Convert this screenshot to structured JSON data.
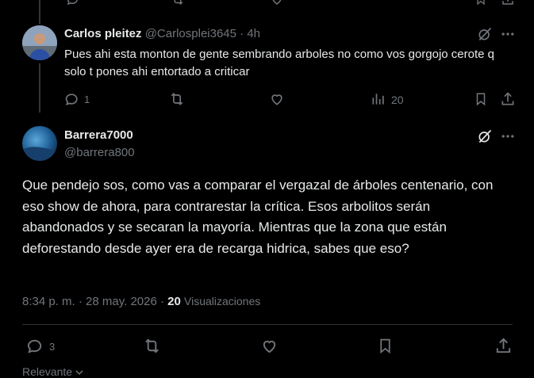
{
  "reply": {
    "author_name": "Carlos pleitez",
    "handle": "@Carlosplei3645",
    "separator": "·",
    "time": "4h",
    "text": "Pues ahi esta monton de gente sembrando arboles no como vos gorgojo cerote q solo t pones ahi entortado a criticar",
    "replies": "1",
    "views": "20"
  },
  "main": {
    "author_name": "Barrera7000",
    "handle": "@barrera800",
    "text": "Que pendejo sos, como vas a comparar  el vergazal de árboles centenario, con eso show de ahora, para contrarestar  la crítica. Esos arbolitos serán abandonados y se secaran la mayoría. Mientras que la zona que están deforestando desde ayer  era de recarga hidrica, sabes que eso?",
    "timestamp": "8:34 p. m. · 28 may. 2026 ·",
    "views_count": "20",
    "views_label": "Visualizaciones",
    "replies": "3"
  },
  "footer": {
    "sort_label": "Relevante"
  },
  "colors": {
    "background": "#000000",
    "text": "#e7e9ea",
    "muted": "#71767b",
    "divider": "#2f3336"
  }
}
